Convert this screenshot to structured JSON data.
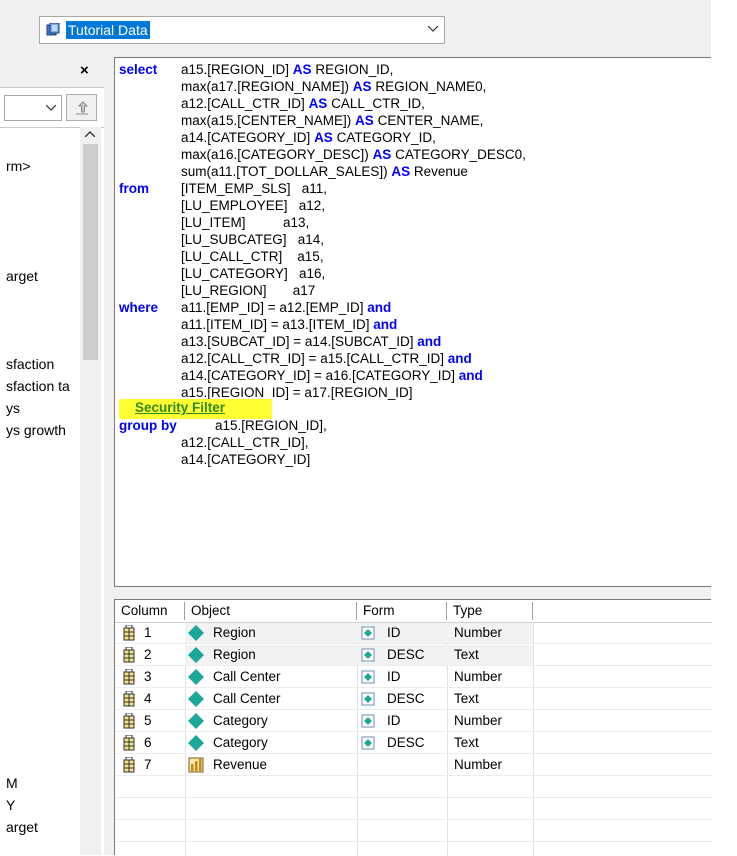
{
  "datasource": {
    "selected": "Tutorial Data",
    "icon": "database-icon"
  },
  "left_panel": {
    "close_label": "×",
    "items": [
      {
        "label": "rm>"
      },
      {
        "label": "arget"
      },
      {
        "label": "sfaction"
      },
      {
        "label": "sfaction ta"
      },
      {
        "label": "ys"
      },
      {
        "label": "ys growth"
      },
      {
        "label": "M"
      },
      {
        "label": "Y"
      },
      {
        "label": "arget"
      }
    ]
  },
  "sql": {
    "lines": [
      {
        "kw": "select",
        "pre": "a15.[REGION_ID] ",
        "k2": "AS",
        "post": " REGION_ID,"
      },
      {
        "kw": "",
        "pre": "max(a17.[REGION_NAME]) ",
        "k2": "AS",
        "post": " REGION_NAME0,"
      },
      {
        "kw": "",
        "pre": "a12.[CALL_CTR_ID] ",
        "k2": "AS",
        "post": " CALL_CTR_ID,"
      },
      {
        "kw": "",
        "pre": "max(a15.[CENTER_NAME]) ",
        "k2": "AS",
        "post": " CENTER_NAME,"
      },
      {
        "kw": "",
        "pre": "a14.[CATEGORY_ID] ",
        "k2": "AS",
        "post": " CATEGORY_ID,"
      },
      {
        "kw": "",
        "pre": "max(a16.[CATEGORY_DESC]) ",
        "k2": "AS",
        "post": " CATEGORY_DESC0,"
      },
      {
        "kw": "",
        "pre": "sum(a11.[TOT_DOLLAR_SALES]) ",
        "k2": "AS",
        "post": " Revenue"
      },
      {
        "kw": "from",
        "pre": "[ITEM_EMP_SLS]   a11,",
        "k2": "",
        "post": ""
      },
      {
        "kw": "",
        "pre": "[LU_EMPLOYEE]   a12,",
        "k2": "",
        "post": ""
      },
      {
        "kw": "",
        "pre": "[LU_ITEM]          a13,",
        "k2": "",
        "post": ""
      },
      {
        "kw": "",
        "pre": "[LU_SUBCATEG]   a14,",
        "k2": "",
        "post": ""
      },
      {
        "kw": "",
        "pre": "[LU_CALL_CTR]    a15,",
        "k2": "",
        "post": ""
      },
      {
        "kw": "",
        "pre": "[LU_CATEGORY]   a16,",
        "k2": "",
        "post": ""
      },
      {
        "kw": "",
        "pre": "[LU_REGION]       a17",
        "k2": "",
        "post": ""
      },
      {
        "kw": "where",
        "pre": "a11.[EMP_ID] = a12.[EMP_ID] ",
        "k2": "and",
        "post": ""
      },
      {
        "kw": "",
        "pre": "a11.[ITEM_ID] = a13.[ITEM_ID] ",
        "k2": "and",
        "post": ""
      },
      {
        "kw": "",
        "pre": "a13.[SUBCAT_ID] = a14.[SUBCAT_ID] ",
        "k2": "and",
        "post": ""
      },
      {
        "kw": "",
        "pre": "a12.[CALL_CTR_ID] = a15.[CALL_CTR_ID] ",
        "k2": "and",
        "post": ""
      },
      {
        "kw": "",
        "pre": "a14.[CATEGORY_ID] = a16.[CATEGORY_ID] ",
        "k2": "and",
        "post": ""
      },
      {
        "kw": "",
        "pre": "a15.[REGION_ID] = a17.[REGION_ID]",
        "k2": "",
        "post": ""
      }
    ],
    "security_filter": "Security Filter",
    "group_by": {
      "kw": "group by",
      "lines": [
        "a15.[REGION_ID],",
        "a12.[CALL_CTR_ID],",
        "a14.[CATEGORY_ID]"
      ]
    }
  },
  "grid": {
    "columns": [
      "Column",
      "Object",
      "Form",
      "Type"
    ],
    "rows": [
      {
        "col": "1",
        "object": "Region",
        "object_icon": "attribute-icon",
        "form": "ID",
        "type": "Number"
      },
      {
        "col": "2",
        "object": "Region",
        "object_icon": "attribute-icon",
        "form": "DESC",
        "type": "Text"
      },
      {
        "col": "3",
        "object": "Call Center",
        "object_icon": "attribute-icon",
        "form": "ID",
        "type": "Number"
      },
      {
        "col": "4",
        "object": "Call Center",
        "object_icon": "attribute-icon",
        "form": "DESC",
        "type": "Text"
      },
      {
        "col": "5",
        "object": "Category",
        "object_icon": "attribute-icon",
        "form": "ID",
        "type": "Number"
      },
      {
        "col": "6",
        "object": "Category",
        "object_icon": "attribute-icon",
        "form": "DESC",
        "type": "Text"
      },
      {
        "col": "7",
        "object": "Revenue",
        "object_icon": "metric-icon",
        "form": "",
        "type": "Number"
      }
    ]
  },
  "colors": {
    "keyword": "#0000ff",
    "security_filter_bg": "#ffff33",
    "security_filter_text": "#2e8b20",
    "attribute": "#1aa89a",
    "selection": "#0078d7"
  }
}
